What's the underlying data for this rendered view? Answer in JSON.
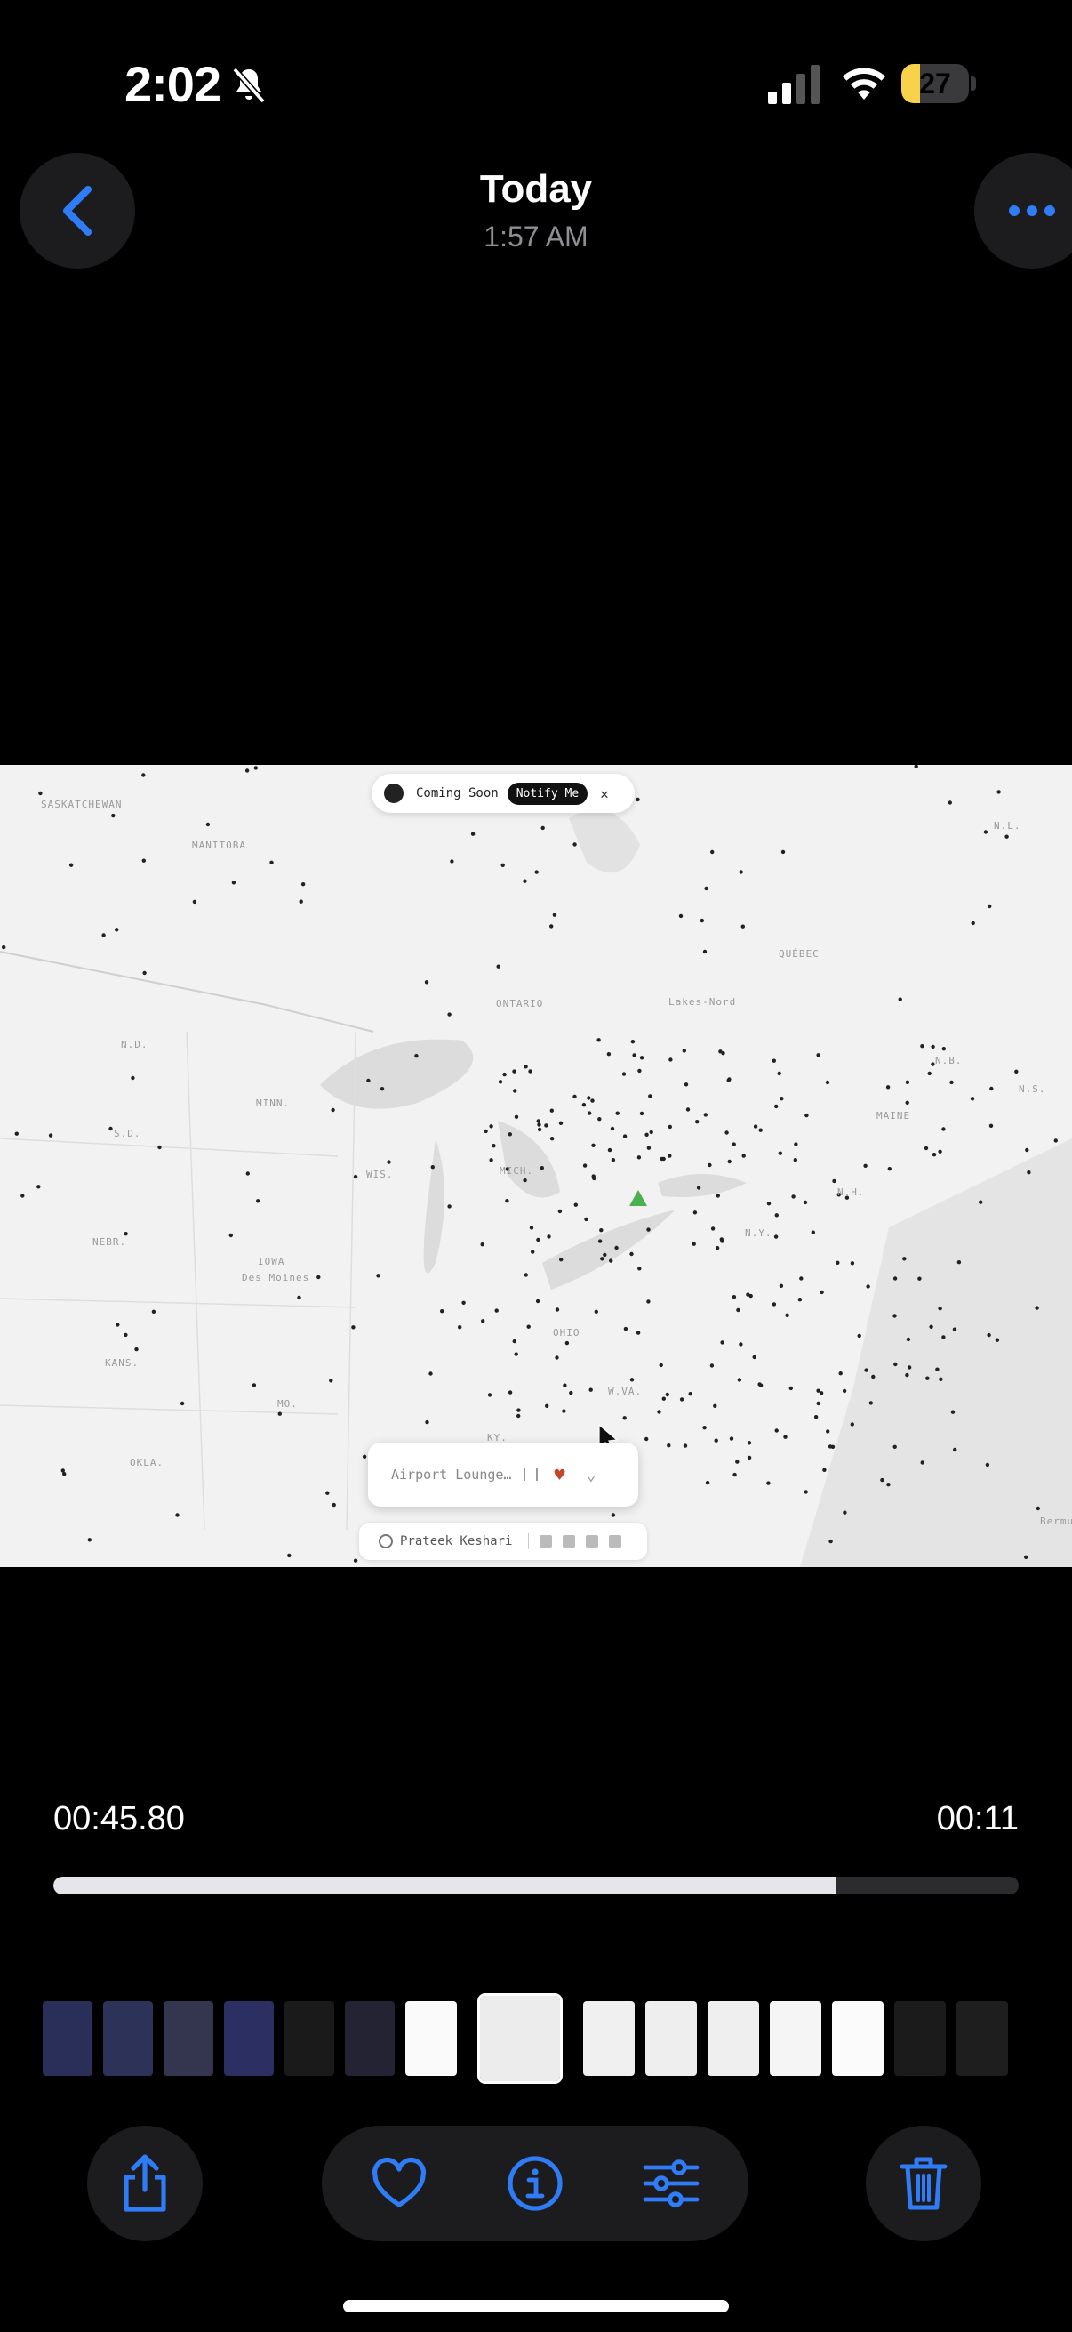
{
  "status_bar": {
    "time": "2:02",
    "battery_level": "27",
    "battery_percent": 27
  },
  "header": {
    "title": "Today",
    "subtitle": "1:57 AM"
  },
  "media": {
    "banner": {
      "label": "Coming Soon",
      "button": "Notify Me",
      "close": "✕"
    },
    "card": {
      "label": "Airport Lounge…"
    },
    "credit": {
      "name": "Prateek Keshari"
    },
    "map_labels": [
      "SASKATCHEWAN",
      "MANITOBA",
      "ONTARIO",
      "QUÉBEC",
      "N.L.",
      "N.D.",
      "MINN.",
      "S.D.",
      "WIS.",
      "MICH.",
      "IOWA",
      "Des Moines",
      "NEBR.",
      "KANS.",
      "MO.",
      "OKLA.",
      "OHIO",
      "W.VA.",
      "N.Y.",
      "N.H.",
      "MAINE",
      "N.B.",
      "N.S.",
      "KY.",
      "Lakes-Nord",
      "Bermuda"
    ]
  },
  "playback": {
    "elapsed": "00:45.80",
    "total": "00:11",
    "progress_fraction": 0.81
  },
  "toolbar": {
    "share": "share-icon",
    "favorite": "heart-icon",
    "info": "info-icon",
    "adjust": "sliders-icon",
    "delete": "trash-icon"
  },
  "colors": {
    "accent": "#2f7cf6",
    "battery": "#f7d24a",
    "chip_bg": "#1c1c1e"
  }
}
